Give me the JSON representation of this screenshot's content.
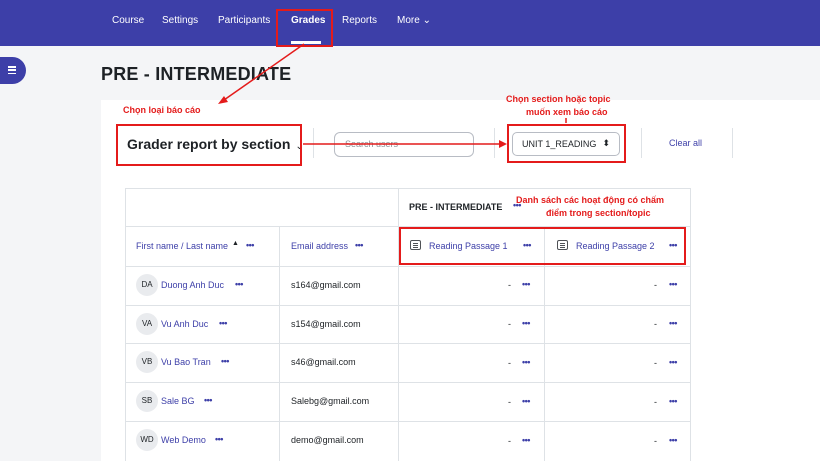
{
  "nav": {
    "items": [
      "Course",
      "Settings",
      "Participants",
      "Grades",
      "Reports",
      "More"
    ],
    "more_chevron": "⌄"
  },
  "page_title": "PRE - INTERMEDIATE",
  "toolbar": {
    "report_type": "Grader report by section",
    "report_chevron": "⌄",
    "search_placeholder": "Search users",
    "section_value": "UNIT 1_READING",
    "section_arrow": "⬍",
    "clear_all": "Clear all"
  },
  "table": {
    "course_header": "PRE - INTERMEDIATE",
    "col_name": "First name / Last name",
    "col_email": "Email address",
    "activities": [
      "Reading Passage 1",
      "Reading Passage 2"
    ],
    "rows": [
      {
        "initials": "DA",
        "name": "Duong Anh Duc",
        "email": "s164@gmail.com",
        "g1": "-",
        "g2": "-"
      },
      {
        "initials": "VA",
        "name": "Vu Anh Duc",
        "email": "s154@gmail.com",
        "g1": "-",
        "g2": "-"
      },
      {
        "initials": "VB",
        "name": "Vu Bao Tran",
        "email": "s46@gmail.com",
        "g1": "-",
        "g2": "-"
      },
      {
        "initials": "SB",
        "name": "Sale BG",
        "email": "Salebg@gmail.com",
        "g1": "-",
        "g2": "-"
      },
      {
        "initials": "WD",
        "name": "Web Demo",
        "email": "demo@gmail.com",
        "g1": "-",
        "g2": "-"
      }
    ]
  },
  "annotations": {
    "choose_report": "Chọn loại báo cáo",
    "choose_section_1": "Chọn section hoặc topic",
    "choose_section_2": "muốn xem báo cáo",
    "activities_1": "Danh sách các hoạt động có chấm",
    "activities_2": "điểm trong section/topic"
  },
  "icons": {
    "ellipsis": "•••",
    "sort_asc": "▲"
  },
  "colors": {
    "nav_bg": "#3d3fa8",
    "link": "#3d3fa8",
    "annotation": "#e41b1b"
  }
}
